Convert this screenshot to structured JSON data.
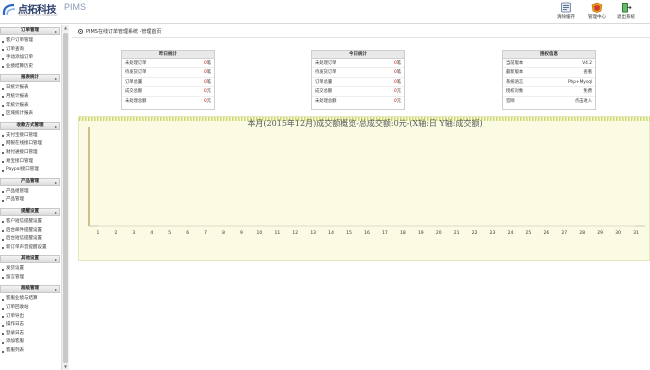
{
  "header": {
    "brand": "点拓科技",
    "product": "PIMS",
    "sub": "DIANTUO TECHNOLOGY",
    "buttons": [
      {
        "label": "清除缓存",
        "icon": "clear-cache-icon"
      },
      {
        "label": "管理中心",
        "icon": "admin-center-icon"
      },
      {
        "label": "退出系统",
        "icon": "logout-icon"
      }
    ]
  },
  "sidebar": {
    "sections": [
      {
        "title": "订单管理",
        "items": [
          "客户订单管理",
          "订单查询",
          "手动添加订单",
          "业绩结算历史"
        ]
      },
      {
        "title": "报表统计",
        "items": [
          "日统计报表",
          "月统计报表",
          "年统计报表",
          "区域统计报表"
        ]
      },
      {
        "title": "收款方式管理",
        "items": [
          "支付宝接口管理",
          "网银在线接口管理",
          "财付通接口管理",
          "易宝接口管理",
          "Paypal接口管理"
        ]
      },
      {
        "title": "产品管理",
        "items": [
          "产品组管理",
          "产品管理"
        ]
      },
      {
        "title": "提醒设置",
        "items": [
          "客户短信提醒设置",
          "后台邮件提醒设置",
          "后台短信提醒设置",
          "新订单声音提醒设置"
        ]
      },
      {
        "title": "其他设置",
        "items": [
          "发货设置",
          "留言管理"
        ]
      },
      {
        "title": "超级管理",
        "items": [
          "客服业绩与结算",
          "订单回收站",
          "订单导出",
          "操作日志",
          "登录日志",
          "添加客服",
          "客服列表"
        ]
      }
    ]
  },
  "breadcrumb": "PIMS在线订单管理系统 -管理首页",
  "panels": [
    {
      "title": "昨日统计",
      "rows": [
        {
          "label": "未处理订单",
          "num": "0",
          "unit": "笔"
        },
        {
          "label": "待发货订单",
          "num": "0",
          "unit": "笔"
        },
        {
          "label": "订单总量",
          "num": "0",
          "unit": "笔"
        },
        {
          "label": "成交总额",
          "num": "0",
          "unit": "元"
        },
        {
          "label": "未处理总额",
          "num": "0",
          "unit": "元"
        }
      ]
    },
    {
      "title": "今日统计",
      "rows": [
        {
          "label": "未处理订单",
          "num": "0",
          "unit": "笔"
        },
        {
          "label": "待发货订单",
          "num": "0",
          "unit": "笔"
        },
        {
          "label": "订单总量",
          "num": "0",
          "unit": "笔"
        },
        {
          "label": "成交总额",
          "num": "0",
          "unit": "元"
        },
        {
          "label": "未处理总额",
          "num": "0",
          "unit": "元"
        }
      ]
    },
    {
      "title": "授权信息",
      "rows": [
        {
          "label": "当前版本",
          "num": "",
          "unit": "V4.2"
        },
        {
          "label": "最新版本",
          "num": "",
          "unit": "查看"
        },
        {
          "label": "系统语言",
          "num": "",
          "unit": "Php+Mysql"
        },
        {
          "label": "授权对象",
          "num": "",
          "unit": "免费"
        },
        {
          "label": "官网",
          "num": "",
          "unit": "点击进入"
        }
      ]
    }
  ],
  "chart_data": {
    "type": "line",
    "title": "本月(2015年12月)成交额概览-总成交额:0元-(X轴:日 Y轴:成交额)",
    "xlabel": "日",
    "ylabel": "成交额",
    "x": [
      1,
      2,
      3,
      4,
      5,
      6,
      7,
      8,
      9,
      10,
      11,
      12,
      13,
      14,
      15,
      16,
      17,
      18,
      19,
      20,
      21,
      22,
      23,
      24,
      25,
      26,
      27,
      28,
      29,
      30,
      31
    ],
    "series": [
      {
        "values": [
          0,
          0,
          0,
          0,
          0,
          0,
          0,
          0,
          0,
          0,
          0,
          0,
          0,
          0,
          0,
          0,
          0,
          0,
          0,
          0,
          0,
          0,
          0,
          0,
          0,
          0,
          0,
          0,
          0,
          0,
          0
        ]
      }
    ],
    "grid": false,
    "background": "#fbfbe4"
  }
}
